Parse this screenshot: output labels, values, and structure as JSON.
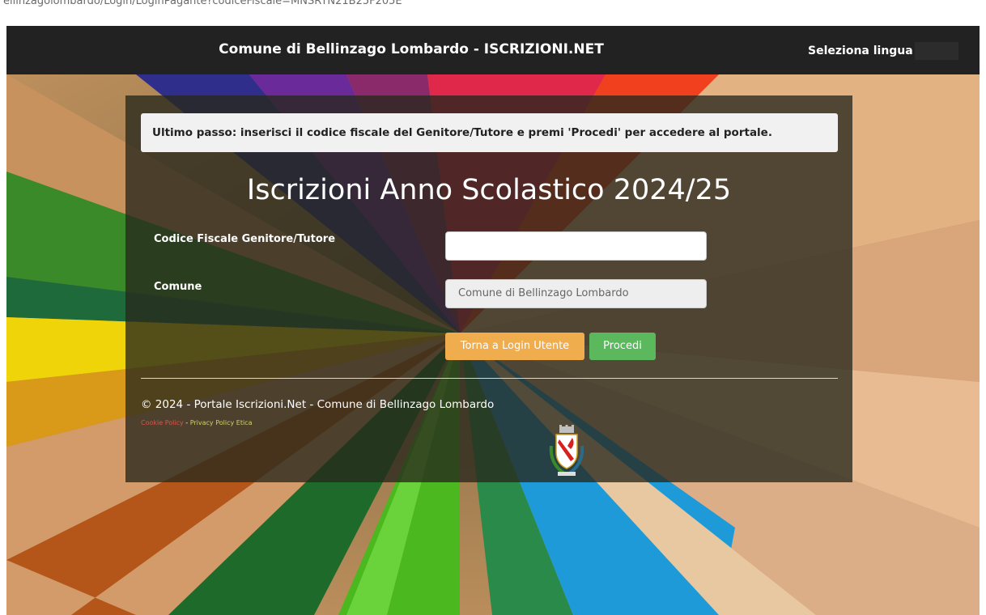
{
  "browser": {
    "url_fragment": "ellinzagolombardo/Login/LoginPagante?codiceFiscale=MNSRYN21B25F205E"
  },
  "navbar": {
    "title": "Comune di Bellinzago Lombardo - ISCRIZIONI.NET",
    "language_button": "Seleziona lingua",
    "background_color": "#222222"
  },
  "form": {
    "notice": "Ultimo passo: inserisci il codice fiscale del Genitore/Tutore e premi 'Procedi' per accedere al portale.",
    "heading": "Iscrizioni Anno Scolastico 2024/25",
    "codice_fiscale_label": "Codice Fiscale Genitore/Tutore",
    "codice_fiscale_value": "",
    "comune_label": "Comune",
    "comune_value": "Comune di Bellinzago Lombardo",
    "back_button": "Torna a Login Utente",
    "proceed_button": "Procedi"
  },
  "footer": {
    "copyright": "© 2024 - Portale Iscrizioni.Net - Comune di Bellinzago Lombardo",
    "cookie_link": "Cookie Policy",
    "separator": "-",
    "privacy_link": "Privacy Policy Etica"
  },
  "colors": {
    "panel_overlay": "rgba(40,40,28,0.78)",
    "back_button": "#f0ad4e",
    "proceed_button": "#5cb85c",
    "cookie_link": "#d9534f",
    "privacy_link": "#d4d06a"
  },
  "icons": {
    "crest": "municipal-coat-of-arms-icon"
  }
}
